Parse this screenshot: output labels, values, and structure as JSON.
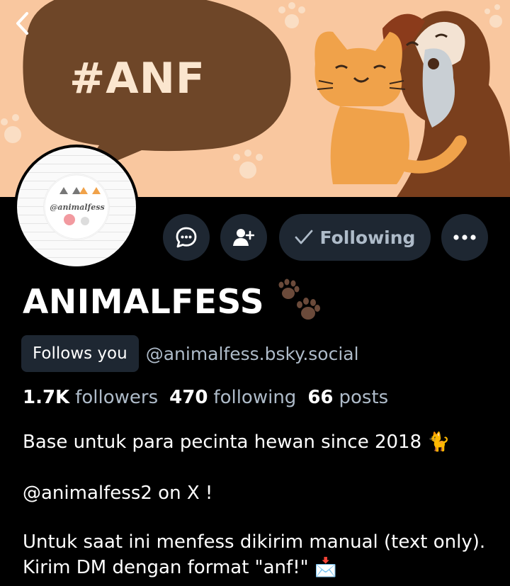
{
  "banner": {
    "hashtag": "#ANF",
    "colors": {
      "background": "#f9c79f",
      "bubble": "#6e4628",
      "tag_text": "#fbe6cf"
    }
  },
  "header": {
    "back_icon": "chevron-left-icon"
  },
  "avatar": {
    "logo_text": "@animalfess"
  },
  "actions": {
    "message_icon": "chat-bubble-icon",
    "add_icon": "person-add-icon",
    "follow_label": "Following",
    "more_icon": "more-horizontal-icon"
  },
  "profile": {
    "display_name": "ANIMALFESS",
    "name_emoji": "paw-prints-icon",
    "follows_you": "Follows you",
    "handle": "@animalfess.bsky.social"
  },
  "stats": {
    "followers_count": "1.7K",
    "followers_label": "followers",
    "following_count": "470",
    "following_label": "following",
    "posts_count": "66",
    "posts_label": "posts"
  },
  "bio": {
    "line1": "Base untuk para pecinta hewan since 2018 🐈",
    "line2": "@animalfess2 on X !",
    "line3": "Untuk saat ini menfess dikirim manual (text only). Kirim DM dengan format \"anf!\" 📩"
  },
  "colors": {
    "button_bg": "#1e2732",
    "muted_text": "#aebbc9"
  }
}
